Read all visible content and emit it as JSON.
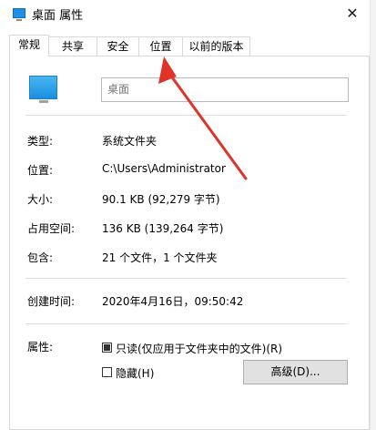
{
  "window": {
    "title": "桌面 属性",
    "close_glyph": "✕"
  },
  "tabs": [
    {
      "label": "常规",
      "active": true
    },
    {
      "label": "共享"
    },
    {
      "label": "安全"
    },
    {
      "label": "位置"
    },
    {
      "label": "以前的版本"
    }
  ],
  "general": {
    "name_value": "桌面",
    "rows": [
      {
        "label": "类型:",
        "value": "系统文件夹"
      },
      {
        "label": "位置:",
        "value": "C:\\Users\\Administrator"
      },
      {
        "label": "大小:",
        "value": "90.1 KB (92,279 字节)"
      },
      {
        "label": "占用空间:",
        "value": "136 KB (139,264 字节)"
      },
      {
        "label": "包含:",
        "value": "21 个文件，1 个文件夹"
      }
    ],
    "created": {
      "label": "创建时间:",
      "value": "2020年4月16日，09:50:42"
    },
    "attributes": {
      "label": "属性:",
      "readonly_label": "只读(仅应用于文件夹中的文件)(R)",
      "readonly_state": "indeterminate",
      "hidden_label": "隐藏(H)",
      "hidden_state": false,
      "advanced_button": "高级(D)..."
    }
  },
  "colors": {
    "accent": "#1e90e6",
    "arrow": "#e0342a"
  },
  "icons": {
    "title": "folder-icon",
    "close": "close-icon",
    "big": "folder-icon"
  }
}
